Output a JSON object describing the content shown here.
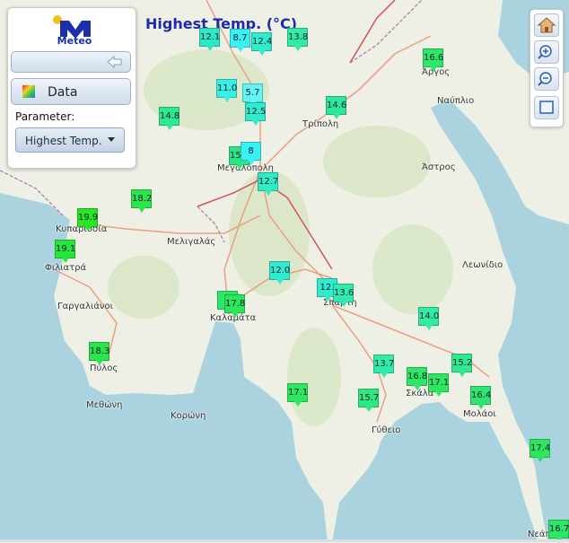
{
  "app": {
    "logo_text": "Meteo",
    "map_title": "Highest Temp. (°C)"
  },
  "panel": {
    "data_label": "Data",
    "parameter_label": "Parameter:",
    "parameter_value": "Highest Temp."
  },
  "tools": [
    "home-icon",
    "zoom-in-icon",
    "zoom-out-icon",
    "extent-icon"
  ],
  "place_labels": [
    {
      "text": "Άργος"
    },
    {
      "text": "Ναύπλιο"
    },
    {
      "text": "Τρίπολη"
    },
    {
      "text": "Άστρος"
    },
    {
      "text": "Μεγαλόπολη"
    },
    {
      "text": "Κυπαρισσία"
    },
    {
      "text": "Μελιγαλάς"
    },
    {
      "text": "Φιλιατρά"
    },
    {
      "text": "Λεωνίδιο"
    },
    {
      "text": "Γαργαλιάνοι"
    },
    {
      "text": "Καλαμάτα"
    },
    {
      "text": "Σπάρτη"
    },
    {
      "text": "Πύλος"
    },
    {
      "text": "Σκάλα"
    },
    {
      "text": "Μολάοι"
    },
    {
      "text": "Μεθώνη"
    },
    {
      "text": "Κορώνη"
    },
    {
      "text": "Γύθειο"
    },
    {
      "text": "Νεάπολη"
    }
  ],
  "stations": [
    {
      "value": "12.1",
      "color": "#2ee7c4"
    },
    {
      "value": "8.7",
      "color": "#39f0f2"
    },
    {
      "value": "12.4",
      "color": "#30ebcc"
    },
    {
      "value": "13.8",
      "color": "#33eba7"
    },
    {
      "value": "16.6",
      "color": "#2fe669"
    },
    {
      "value": "11.0",
      "color": "#37efe2"
    },
    {
      "value": "5.7",
      "color": "#62f4f7"
    },
    {
      "value": "12.5",
      "color": "#30ebcc"
    },
    {
      "value": "14.6",
      "color": "#2fe79b"
    },
    {
      "value": "14.8",
      "color": "#2fe88f"
    },
    {
      "value": "15.4",
      "color": "#2ee585"
    },
    {
      "value": "8",
      "color": "#39f0f2"
    },
    {
      "value": "12.7",
      "color": "#30ebc6"
    },
    {
      "value": "18.2",
      "color": "#2be54e"
    },
    {
      "value": "19.9",
      "color": "#26e625"
    },
    {
      "value": "19.1",
      "color": "#25e63a"
    },
    {
      "value": "12.0",
      "color": "#30ebd0"
    },
    {
      "value": "12.",
      "color": "#30ebce"
    },
    {
      "value": "13.6",
      "color": "#30ebad"
    },
    {
      "value": "1",
      "color": "#2ee86a"
    },
    {
      "value": "17.8",
      "color": "#2be55a"
    },
    {
      "value": "14.0",
      "color": "#33eba2"
    },
    {
      "value": "18.3",
      "color": "#2be54c"
    },
    {
      "value": "13.7",
      "color": "#32eba9"
    },
    {
      "value": "15.2",
      "color": "#2fe890"
    },
    {
      "value": "16.8",
      "color": "#2ee766"
    },
    {
      "value": "17.1",
      "color": "#2ee760"
    },
    {
      "value": "16.4",
      "color": "#2ee66f"
    },
    {
      "value": "17.1",
      "color": "#2ee760"
    },
    {
      "value": "15.7",
      "color": "#30e781"
    },
    {
      "value": "17.4",
      "color": "#2ee65c"
    },
    {
      "value": "16.7",
      "color": "#2ee668"
    }
  ]
}
